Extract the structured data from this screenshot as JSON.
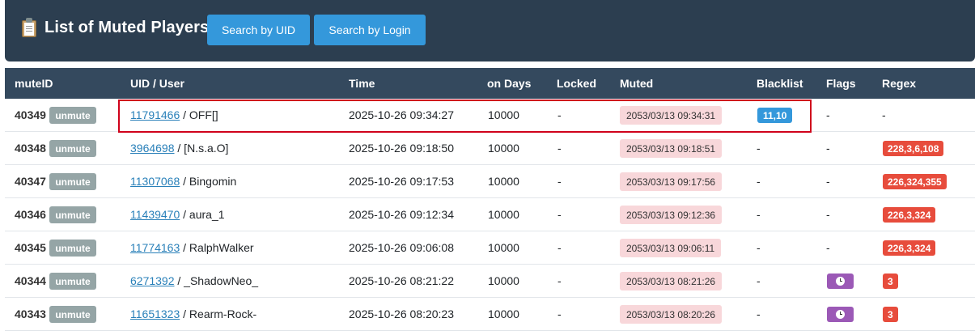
{
  "header": {
    "title": "List of Muted Players",
    "search_uid_label": "Search by UID",
    "search_login_label": "Search by Login"
  },
  "columns": [
    "muteID",
    "UID / User",
    "Time",
    "on Days",
    "Locked",
    "Muted",
    "Blacklist",
    "Flags",
    "Regex"
  ],
  "unmute_label": "unmute",
  "rows": [
    {
      "mute_id": "40349",
      "uid": "11791466",
      "user": " / OFF[]",
      "time": "2025-10-26 09:34:27",
      "days": "10000",
      "locked": "-",
      "muted": "2053/03/13 09:34:31",
      "blacklist": "11,10",
      "flags": "-",
      "flag_icon": "",
      "regex": "-"
    },
    {
      "mute_id": "40348",
      "uid": "3964698",
      "user": " / [N.s.a.O]",
      "time": "2025-10-26 09:18:50",
      "days": "10000",
      "locked": "-",
      "muted": "2053/03/13 09:18:51",
      "blacklist": "-",
      "flags": "-",
      "flag_icon": "",
      "regex": "228,3,6,108"
    },
    {
      "mute_id": "40347",
      "uid": "11307068",
      "user": " / Bingomin",
      "time": "2025-10-26 09:17:53",
      "days": "10000",
      "locked": "-",
      "muted": "2053/03/13 09:17:56",
      "blacklist": "-",
      "flags": "-",
      "flag_icon": "",
      "regex": "226,324,355"
    },
    {
      "mute_id": "40346",
      "uid": "11439470",
      "user": " / aura_1",
      "time": "2025-10-26 09:12:34",
      "days": "10000",
      "locked": "-",
      "muted": "2053/03/13 09:12:36",
      "blacklist": "-",
      "flags": "-",
      "flag_icon": "",
      "regex": "226,3,324"
    },
    {
      "mute_id": "40345",
      "uid": "11774163",
      "user": " / RalphWalker",
      "time": "2025-10-26 09:06:08",
      "days": "10000",
      "locked": "-",
      "muted": "2053/03/13 09:06:11",
      "blacklist": "-",
      "flags": "-",
      "flag_icon": "",
      "regex": "226,3,324"
    },
    {
      "mute_id": "40344",
      "uid": "6271392",
      "user": " / _ShadowNeo_",
      "time": "2025-10-26 08:21:22",
      "days": "10000",
      "locked": "-",
      "muted": "2053/03/13 08:21:26",
      "blacklist": "-",
      "flags": "",
      "flag_icon": "clock-icon",
      "regex": "3"
    },
    {
      "mute_id": "40343",
      "uid": "11651323",
      "user": " / Rearm-Rock-",
      "time": "2025-10-26 08:20:23",
      "days": "10000",
      "locked": "-",
      "muted": "2053/03/13 08:20:26",
      "blacklist": "-",
      "flags": "",
      "flag_icon": "clock-icon",
      "regex": "3"
    }
  ],
  "colors": {
    "header_bg": "#2c3e50",
    "table_header_bg": "#34495e",
    "button_blue": "#3498db",
    "unmute_gray": "#95a5a6",
    "muted_pink": "#f8d7da",
    "regex_red": "#e74c3c",
    "flag_purple": "#9b59b6",
    "highlight_red": "#d0021b"
  }
}
